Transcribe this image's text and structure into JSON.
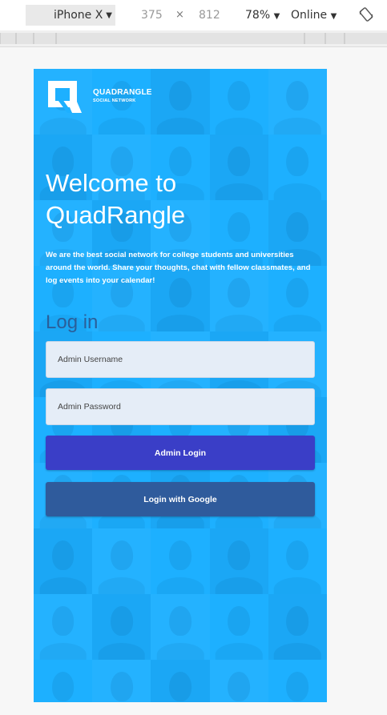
{
  "devtools": {
    "device": "iPhone X",
    "width": "375",
    "times": "×",
    "height": "812",
    "zoom": "78%",
    "network": "Online"
  },
  "colors": {
    "background_blue": "#1db0ff",
    "admin_button": "#3a3ec7",
    "google_button": "#2f5b9c",
    "login_heading": "#2a5f9a",
    "field_bg": "#e5edf7"
  },
  "brand": {
    "name": "QUADRANGLE",
    "tagline": "SOCIAL NETWORK",
    "logo_icon": "quadrangle-q-logo"
  },
  "hero": {
    "title_line1": "Welcome to",
    "title_line2": "QuadRangle",
    "intro": "We are the best social network for college students and universities around the world. Share your thoughts, chat with fellow classmates, and log events into your calendar!"
  },
  "login": {
    "heading": "Log in",
    "username_placeholder": "Admin Username",
    "password_placeholder": "Admin Password",
    "admin_button": "Admin Login",
    "google_button": "Login with Google"
  }
}
